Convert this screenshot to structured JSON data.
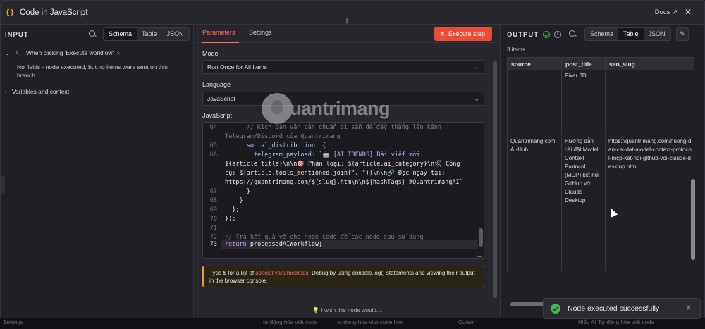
{
  "window": {
    "title": "Code in JavaScript",
    "docs_label": "Docs",
    "close_glyph": "✕",
    "title_icon_glyph": "{}"
  },
  "input": {
    "title": "INPUT",
    "view_tabs": [
      "Schema",
      "Table",
      "JSON"
    ],
    "active_view": "Schema",
    "trigger_label": "When clicking 'Execute workflow'",
    "no_fields_message": "No fields - node executed, but no items were sent on this branch",
    "variables_label": "Variables and context"
  },
  "parameters": {
    "tabs": [
      "Parameters",
      "Settings"
    ],
    "active_tab": "Parameters",
    "execute_label": "Execute step",
    "mode_label": "Mode",
    "mode_value": "Run Once for All Items",
    "language_label": "Language",
    "language_value": "JavaScript",
    "code_label": "JavaScript",
    "hint_prefix": "Type $ for a list of ",
    "hint_link": "special vars/methods",
    "hint_suffix": ". Debug by using console.log() statements and viewing their output in the browser console.",
    "wish_label": "I wish this node would..."
  },
  "code": {
    "line_numbers": [
      "64",
      "",
      "65",
      "66",
      "",
      "",
      "",
      "67",
      "68",
      "69",
      "70",
      "71",
      "72",
      "73"
    ],
    "active_line": "73",
    "lines": {
      "l64": "      // Kịch bản văn bản chuẩn bị sẵn để đẩy thẳng lên kênh",
      "l64b": "Telegram/Discord của Quantrimang",
      "l65": "      social_distribution: {",
      "l66a_prop": "        telegram_payload: ",
      "l66a_str": "`🤖 [AI TRENDS] Bài viết mới:",
      "l66b": "${article.title}\\n\\n🎯 Phân loại: ${article.ai_category}\\n🛠 Công",
      "l66c": "cụ: ${article.tools_mentioned.join(\", \")}\\n\\n🔗 Đọc ngay tại:",
      "l66d": "https://quantrimang.com/${slug}.htm\\n\\n${hashTags} #QuantrimangAI`",
      "l67": "      }",
      "l68": "    }",
      "l69": "  };",
      "l70": "});",
      "l71": "",
      "l72": "// Trả kết quả về cho node Code để các node sau sử dụng",
      "l73_kw": "return ",
      "l73_var": "processedAIWorkflow;"
    }
  },
  "output": {
    "title": "OUTPUT",
    "view_tabs": [
      "Schema",
      "Table",
      "JSON"
    ],
    "active_view": "Table",
    "items_count": "3 items",
    "columns": [
      "source",
      "post_title",
      "seo_slug"
    ],
    "rows": [
      {
        "source": "",
        "post_title": "Pixar 3D",
        "seo_slug": ""
      },
      {
        "source": "Quantrimang.com AI-Hub",
        "post_title": "Hướng dẫn cài đặt Model Context Protocol (MCP) kết nối GitHub với Claude Desktop",
        "seo_slug": "https://quantrimang.com/huong-dan-cai-dat-model-context-protocol-mcp-ket-noi-github-voi-claude-desktop.htm"
      }
    ]
  },
  "toast": {
    "message": "Node executed successfully",
    "close_glyph": "✕"
  },
  "watermark": {
    "text": "uantrimang"
  },
  "background": {
    "items": [
      "Settings",
      "tự động hóa viết code",
      "tu-dong-hoa-viet-code.htm",
      "Cursor",
      "Hiểu AI Tự động hóa viết code"
    ]
  },
  "colors": {
    "accent": "#ff6d5a",
    "execute_button": "#ec4b36",
    "success": "#3fb950",
    "hint_border": "#e0a030"
  }
}
